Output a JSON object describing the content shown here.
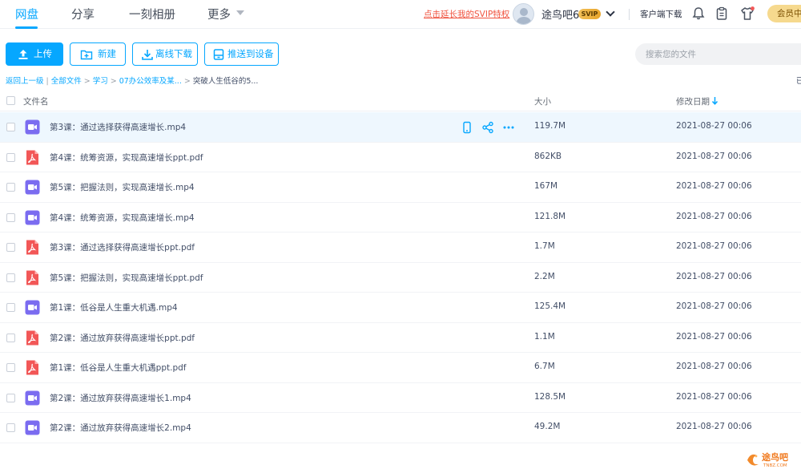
{
  "nav": {
    "items": [
      "网盘",
      "分享",
      "一刻相册",
      "更多"
    ],
    "promo": "点击延长我的SVIP特权",
    "username": "途鸟吧6",
    "badge": "SVIP",
    "client_download": "客户端下载",
    "vip_button": "会员中心"
  },
  "toolbar": {
    "upload": "上传",
    "new": "新建",
    "offline_download": "离线下载",
    "push_device": "推送到设备",
    "search_placeholder": "搜索您的文件"
  },
  "breadcrumb": {
    "back": "返回上一级",
    "all_files": "全部文件",
    "path": [
      "学习",
      "07办公效率及某..."
    ],
    "current": "突破人生低谷的5...",
    "right_cut": "已"
  },
  "table": {
    "headers": {
      "name": "文件名",
      "size": "大小",
      "modified": "修改日期"
    },
    "rows": [
      {
        "name": "第3课：通过选择获得高速增长.mp4",
        "type": "video",
        "size": "119.7M",
        "date": "2021-08-27 00:06"
      },
      {
        "name": "第4课：统筹资源，实现高速增长ppt.pdf",
        "type": "pdf",
        "size": "862KB",
        "date": "2021-08-27 00:06"
      },
      {
        "name": "第5课：把握法则，实现高速增长.mp4",
        "type": "video",
        "size": "167M",
        "date": "2021-08-27 00:06"
      },
      {
        "name": "第4课：统筹资源，实现高速增长.mp4",
        "type": "video",
        "size": "121.8M",
        "date": "2021-08-27 00:06"
      },
      {
        "name": "第3课：通过选择获得高速增长ppt.pdf",
        "type": "pdf",
        "size": "1.7M",
        "date": "2021-08-27 00:06"
      },
      {
        "name": "第5课：把握法则，实现高速增长ppt.pdf",
        "type": "pdf",
        "size": "2.2M",
        "date": "2021-08-27 00:06"
      },
      {
        "name": "第1课：低谷是人生重大机遇.mp4",
        "type": "video",
        "size": "125.4M",
        "date": "2021-08-27 00:06"
      },
      {
        "name": "第2课：通过放弃获得高速增长ppt.pdf",
        "type": "pdf",
        "size": "1.1M",
        "date": "2021-08-27 00:06"
      },
      {
        "name": "第1课：低谷是人生重大机遇ppt.pdf",
        "type": "pdf",
        "size": "6.7M",
        "date": "2021-08-27 00:06"
      },
      {
        "name": "第2课：通过放弃获得高速增长1.mp4",
        "type": "video",
        "size": "128.5M",
        "date": "2021-08-27 00:06"
      },
      {
        "name": "第2课：通过放弃获得高速增长2.mp4",
        "type": "video",
        "size": "49.2M",
        "date": "2021-08-27 00:06"
      }
    ]
  },
  "watermark": {
    "text": "途鸟吧",
    "sub": "TNBZ.COM"
  },
  "colors": {
    "accent": "#06a7ff",
    "video": "#7b6cf0",
    "pdf": "#f25757",
    "promo": "#f0533f"
  }
}
